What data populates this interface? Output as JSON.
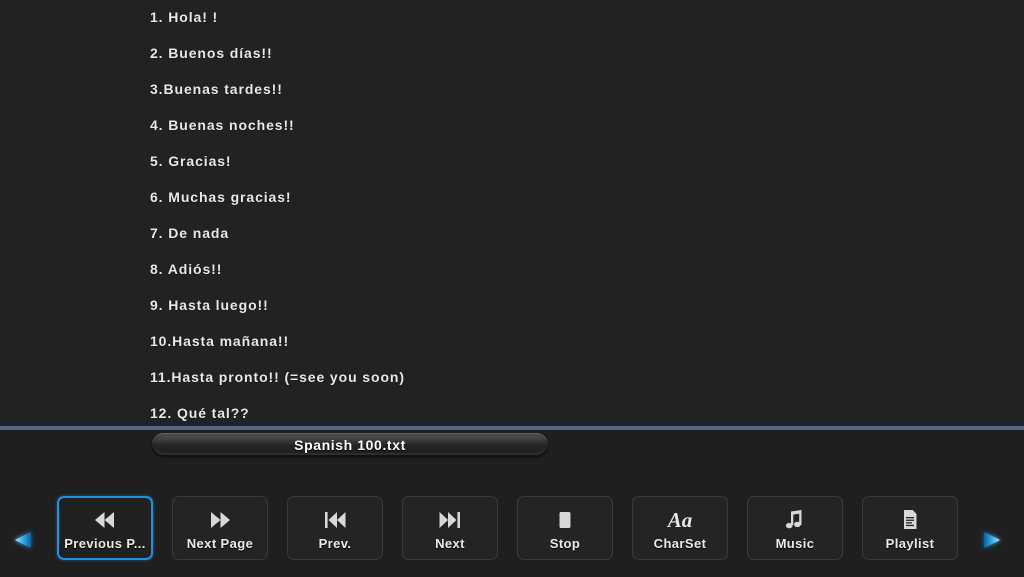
{
  "reader": {
    "lines": [
      "1. Hola! !",
      "2. Buenos días!!",
      "3.Buenas tardes!!",
      "4. Buenas noches!!",
      "5. Gracias!",
      "6. Muchas gracias!",
      "7. De nada",
      "8. Adiós!!",
      "9. Hasta luego!!",
      "10.Hasta mañana!!",
      "11.Hasta pronto!! (=see you soon)",
      "12. Qué tal??"
    ]
  },
  "statusbar": {
    "title": "Spanish 100.txt"
  },
  "toolbar": {
    "buttons": [
      {
        "label": "Previous P...",
        "icon": "rewind-double-left-icon",
        "focused": true
      },
      {
        "label": "Next Page",
        "icon": "forward-double-right-icon",
        "focused": false
      },
      {
        "label": "Prev.",
        "icon": "skip-back-icon",
        "focused": false
      },
      {
        "label": "Next",
        "icon": "skip-forward-icon",
        "focused": false
      },
      {
        "label": "Stop",
        "icon": "stop-square-icon",
        "focused": false
      },
      {
        "label": "CharSet",
        "icon": "charset-aa-icon",
        "glyph": "Aa",
        "focused": false
      },
      {
        "label": "Music",
        "icon": "music-note-icon",
        "focused": false
      },
      {
        "label": "Playlist",
        "icon": "playlist-document-icon",
        "focused": false
      }
    ]
  },
  "navigation": {
    "left_arrow_icon": "triangle-left-icon",
    "right_arrow_icon": "triangle-right-icon"
  },
  "colors": {
    "background": "#222222",
    "shell": "#1f1f1f",
    "text": "#e9e9e9",
    "focus_accent": "#1e91e0",
    "separator_light": "#58637e",
    "separator_dark": "#1c2233",
    "arrow_accent": "#29a8ea"
  }
}
